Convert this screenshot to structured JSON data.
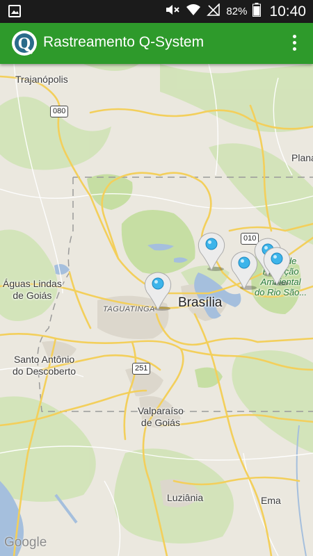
{
  "status_bar": {
    "battery_percent": "82%",
    "time": "10:40",
    "icons": [
      "gallery-icon",
      "mute-icon",
      "wifi-icon",
      "no-signal-icon",
      "battery-icon"
    ]
  },
  "app_bar": {
    "logo_letter": "Q",
    "title": "Rastreamento Q-System",
    "overflow_icon": "more-vert-icon"
  },
  "map": {
    "places": {
      "trajanopolis": "Trajanópolis",
      "plana": "Plana",
      "aguas_lindas": "Águas Lindas\nde Goiás",
      "taguatinga": "TAGUATINGA",
      "brasilia": "Brasília",
      "santo_antonio": "Santo Antônio\ndo Descoberto",
      "valparaiso": "Valparaíso\nde Goiás",
      "luziania": "Luziânia",
      "ema": "Ema",
      "area_protecao": "Área de\nProteção\nAmbiental\ndo Rio São..."
    },
    "road_shields": {
      "r080": "080",
      "r010": "010",
      "r251": "251"
    },
    "attribution": "Google",
    "marker_count": 5,
    "colors": {
      "app_bar": "#2e9a2b",
      "marker_dot": "#3cb4ea",
      "water": "#a5bfdd",
      "park": "#c9dfaa",
      "road": "#f7d86a"
    }
  }
}
